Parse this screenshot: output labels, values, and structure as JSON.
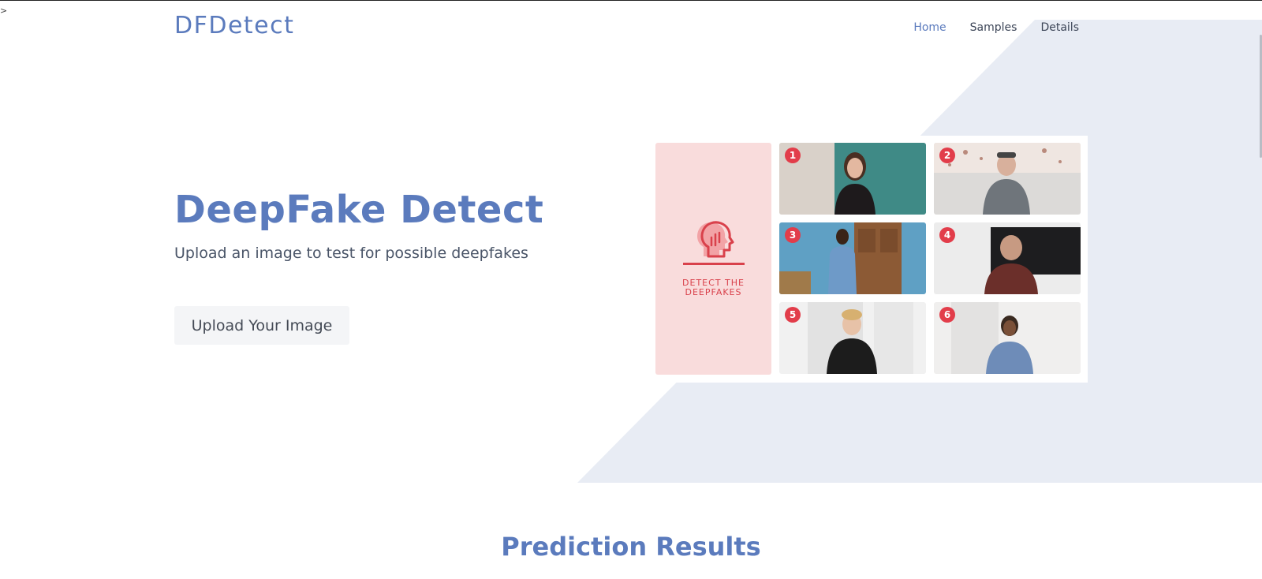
{
  "brand": {
    "name": "DFDetect"
  },
  "nav": {
    "items": [
      "Home",
      "Samples",
      "Details"
    ],
    "active": "Home"
  },
  "hero": {
    "title": "DeepFake Detect",
    "subtitle": "Upload an image to test for possible deepfakes",
    "upload_label": "Upload Your Image"
  },
  "collage": {
    "panel_caption_line1": "DETECT THE",
    "panel_caption_line2": "DEEPFAKES",
    "tiles": [
      "1",
      "2",
      "3",
      "4",
      "5",
      "6"
    ]
  },
  "results": {
    "title": "Prediction Results"
  },
  "misc": {
    "stray_char": ">"
  },
  "colors": {
    "accent": "#5b7bbd",
    "background_shape": "#e8ecf4",
    "panel_pink": "#f9dcdc",
    "badge_red": "#e23d4a"
  }
}
